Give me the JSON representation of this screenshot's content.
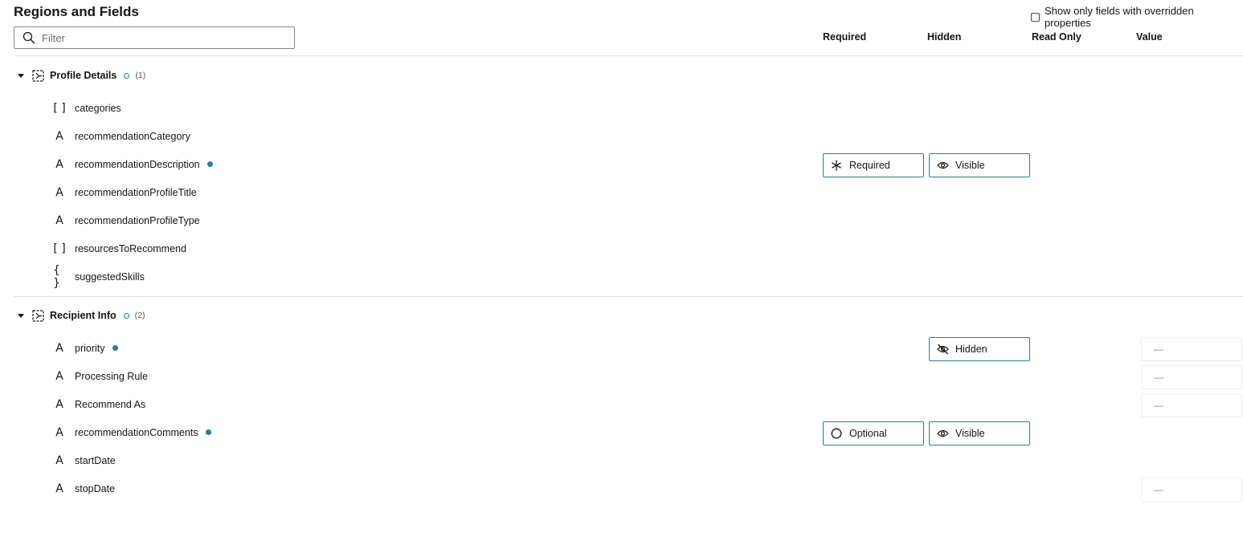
{
  "header": {
    "title": "Regions and Fields",
    "override_toggle_label": "Show only fields with overridden properties"
  },
  "filter": {
    "placeholder": "Filter",
    "value": ""
  },
  "columns": {
    "required": "Required",
    "hidden": "Hidden",
    "read_only": "Read Only",
    "value": "Value"
  },
  "sections": [
    {
      "title": "Profile Details",
      "count": "(1)",
      "fields": [
        {
          "name": "categories",
          "icon": "array-icon"
        },
        {
          "name": "recommendationCategory",
          "icon": "text-icon"
        },
        {
          "name": "recommendationDescription",
          "icon": "text-icon",
          "overridden": true,
          "required": "Required",
          "visibility": "Visible"
        },
        {
          "name": "recommendationProfileTitle",
          "icon": "text-icon"
        },
        {
          "name": "recommendationProfileType",
          "icon": "text-icon"
        },
        {
          "name": "resourcesToRecommend",
          "icon": "array-icon"
        },
        {
          "name": "suggestedSkills",
          "icon": "object-icon"
        }
      ]
    },
    {
      "title": "Recipient Info",
      "count": "(2)",
      "fields": [
        {
          "name": "priority",
          "icon": "text-icon",
          "overridden": true,
          "visibility": "Hidden",
          "value": "—"
        },
        {
          "name": "Processing Rule",
          "icon": "text-icon",
          "value": "—"
        },
        {
          "name": "Recommend As",
          "icon": "text-icon",
          "value": "—"
        },
        {
          "name": "recommendationComments",
          "icon": "text-icon",
          "overridden": true,
          "required": "Optional",
          "visibility": "Visible"
        },
        {
          "name": "startDate",
          "icon": "text-icon"
        },
        {
          "name": "stopDate",
          "icon": "text-icon",
          "value": "—"
        }
      ]
    }
  ],
  "colors": {
    "accent": "#227e9e",
    "text": "#161513",
    "divider": "#e4e2df"
  }
}
